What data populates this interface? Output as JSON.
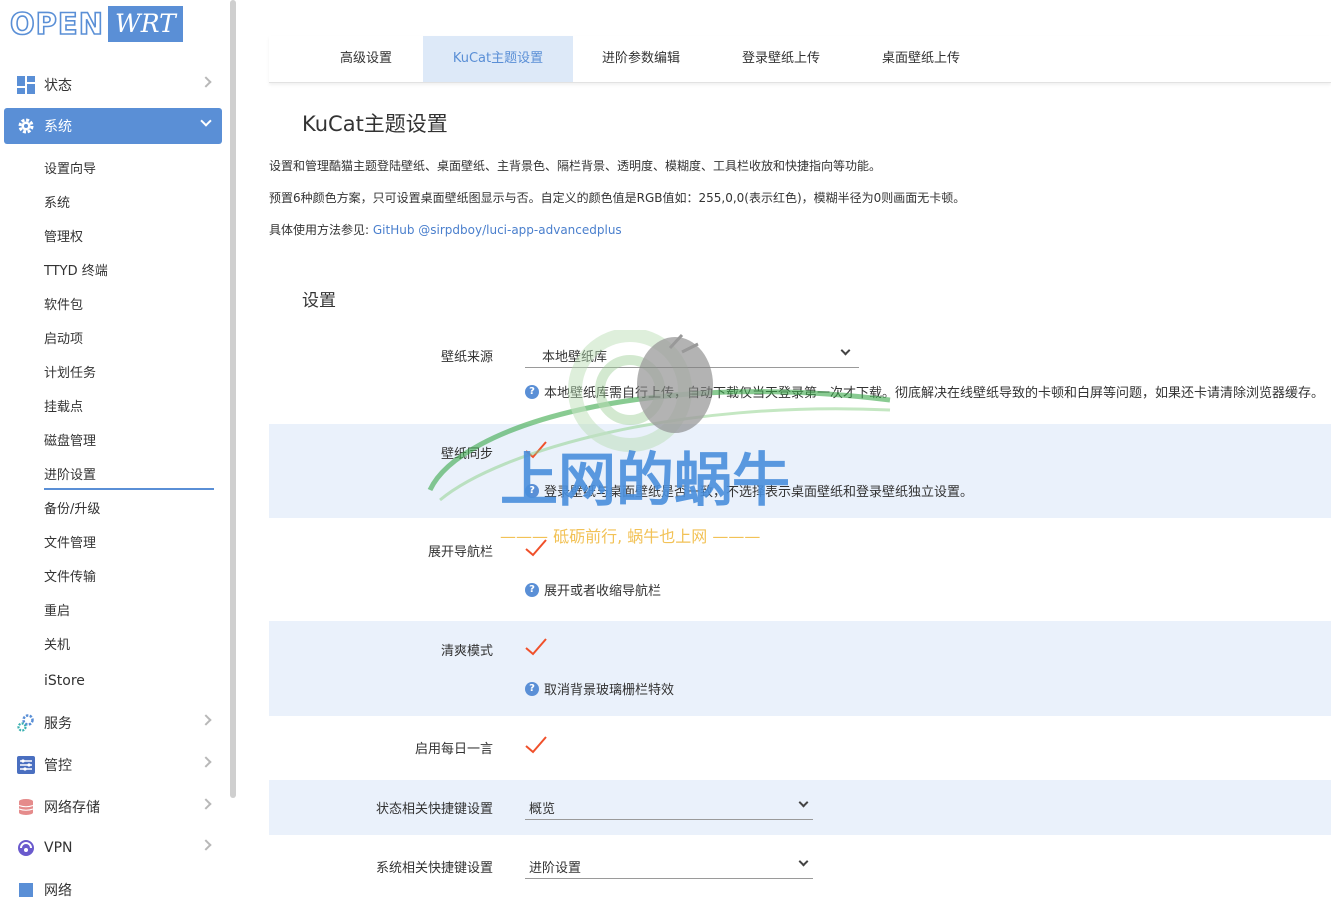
{
  "logo": {
    "open": "OPEN",
    "wrt": "WRT"
  },
  "sidebar": {
    "top": [
      {
        "label": "状态",
        "icon": "dashboard-icon"
      },
      {
        "label": "系统",
        "icon": "gear-icon"
      },
      {
        "label": "服务",
        "icon": "services-icon"
      },
      {
        "label": "管控",
        "icon": "control-icon"
      },
      {
        "label": "网络存储",
        "icon": "storage-icon"
      },
      {
        "label": "VPN",
        "icon": "vpn-icon"
      },
      {
        "label": "网络",
        "icon": "network-icon"
      }
    ],
    "sub": [
      "设置向导",
      "系统",
      "管理权",
      "TTYD 终端",
      "软件包",
      "启动项",
      "计划任务",
      "挂载点",
      "磁盘管理",
      "进阶设置",
      "备份/升级",
      "文件管理",
      "文件传输",
      "重启",
      "关机",
      "iStore"
    ]
  },
  "tabs": [
    "高级设置",
    "KuCat主题设置",
    "进阶参数编辑",
    "登录壁纸上传",
    "桌面壁纸上传"
  ],
  "page": {
    "title": "KuCat主题设置",
    "desc1": "设置和管理酷猫主题登陆壁纸、桌面壁纸、主背景色、隔栏背景、透明度、模糊度、工具栏收放和快捷指向等功能。",
    "desc2": "预置6种颜色方案，只可设置桌面壁纸图显示与否。自定义的颜色值是RGB值如：255,0,0(表示红色)，模糊半径为0则画面无卡顿。",
    "desc3_prefix": "具体使用方法参见:",
    "desc3_link": "GitHub @sirpdboy/luci-app-advancedplus",
    "section": "设置"
  },
  "settings": {
    "wallpaper_source": {
      "label": "壁纸来源",
      "value": "本地壁纸库",
      "hint": "本地壁纸库需自行上传，自动下载仅当天登录第一次才下载。彻底解决在线壁纸导致的卡顿和白屏等问题，如果还卡请清除浏览器缓存。"
    },
    "wallpaper_sync": {
      "label": "壁纸同步",
      "hint": "登录壁纸与桌面壁纸是否一致，不选择表示桌面壁纸和登录壁纸独立设置。"
    },
    "expand_nav": {
      "label": "展开导航栏",
      "hint": "展开或者收缩导航栏"
    },
    "clean_mode": {
      "label": "清爽模式",
      "hint": "取消背景玻璃栅栏特效"
    },
    "daily_quote": {
      "label": "启用每日一言"
    },
    "status_shortcut": {
      "label": "状态相关快捷键设置",
      "value": "概览"
    },
    "system_shortcut": {
      "label": "系统相关快捷键设置",
      "value": "进阶设置"
    }
  },
  "watermark": {
    "title": "上网的蜗牛",
    "slogan": "——— 砥砺前行, 蜗牛也上网 ———"
  },
  "colors": {
    "accent": "#5a8fd6",
    "check": "#f0502a",
    "band": "#eaf1fb"
  }
}
